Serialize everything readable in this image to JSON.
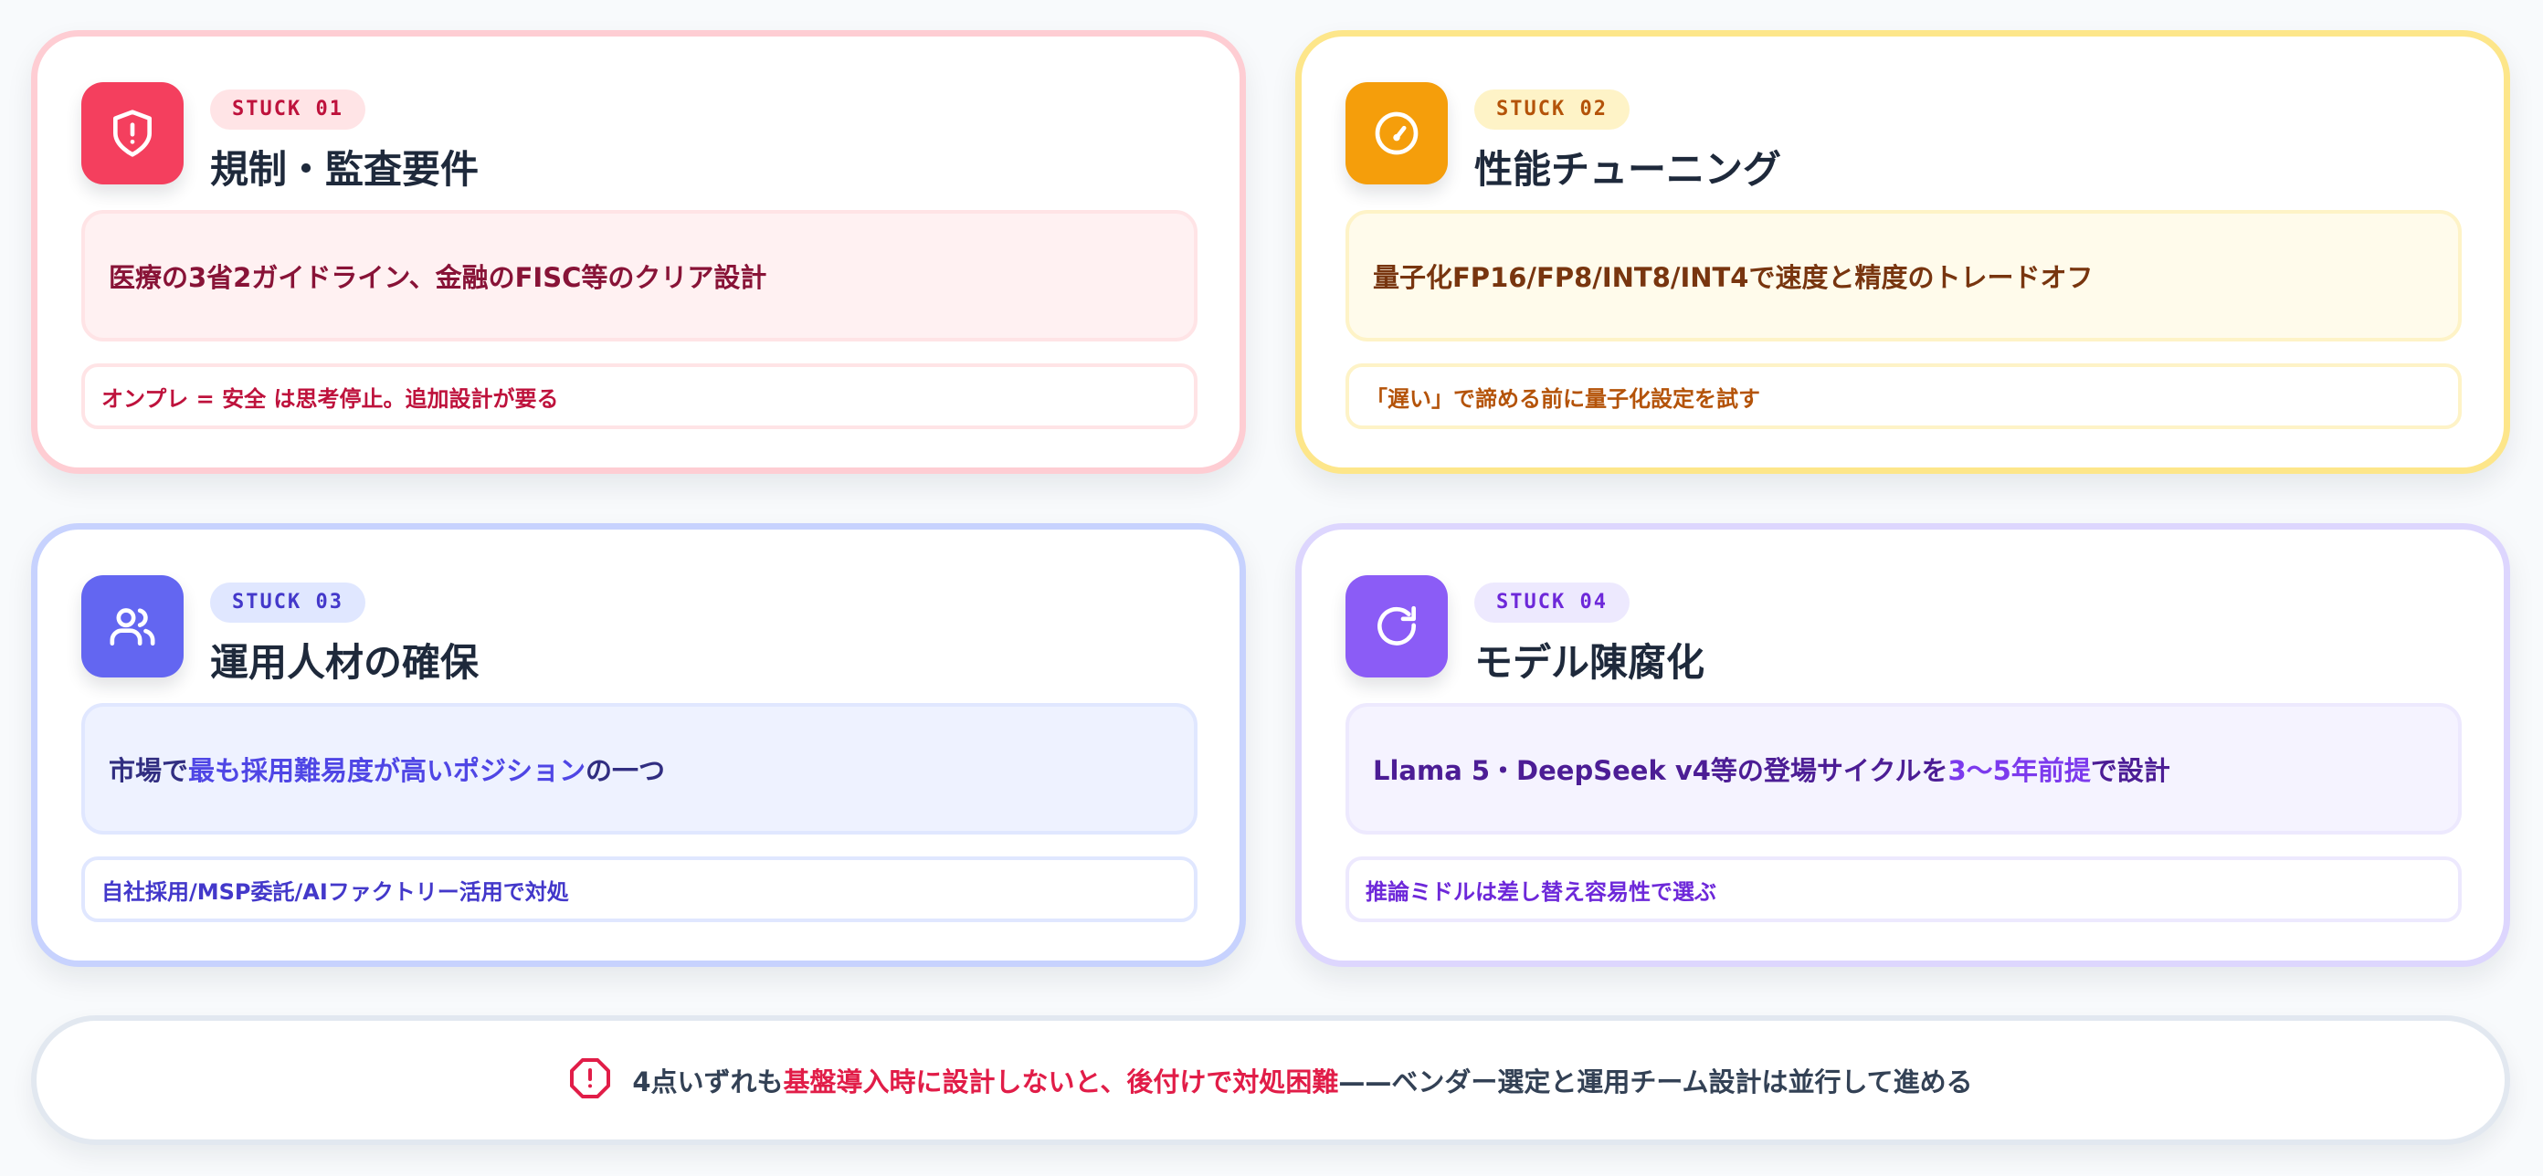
{
  "cards": [
    {
      "badge": "STUCK 01",
      "title": "規制・監査要件",
      "main": {
        "pre": "医療の3省2ガイドライン、金融のFISC等のクリア設計",
        "highlight": "",
        "post": ""
      },
      "note": "オンプレ = 安全 は思考停止。追加設計が要る",
      "icon": "shield-alert-icon",
      "accent": "#f43f5e"
    },
    {
      "badge": "STUCK 02",
      "title": "性能チューニング",
      "main": {
        "pre": "量子化FP16/FP8/INT8/INT4で速度と精度のトレードオフ",
        "highlight": "",
        "post": ""
      },
      "note": "「遅い」で諦める前に量子化設定を試す",
      "icon": "gauge-icon",
      "accent": "#f59e0b"
    },
    {
      "badge": "STUCK 03",
      "title": "運用人材の確保",
      "main": {
        "pre": "市場で",
        "highlight": "最も採用難易度が高いポジション",
        "post": "の一つ"
      },
      "note": "自社採用/MSP委託/AIファクトリー活用で対処",
      "icon": "users-icon",
      "accent": "#6366f1"
    },
    {
      "badge": "STUCK 04",
      "title": "モデル陳腐化",
      "main": {
        "pre": "Llama 5・DeepSeek v4等の登場サイクルを",
        "highlight": "3〜5年前提",
        "post": "で設計"
      },
      "note": "推論ミドルは差し替え容易性で選ぶ",
      "icon": "refresh-icon",
      "accent": "#8b5cf6"
    }
  ],
  "footer": {
    "icon": "alert-circle-icon",
    "pre": "4点いずれも",
    "highlight": "基盤導入時に設計しないと、後付けで対処困難",
    "post": "——ベンダー選定と運用チーム設計は並行して進める",
    "accent": "#e11d48"
  }
}
